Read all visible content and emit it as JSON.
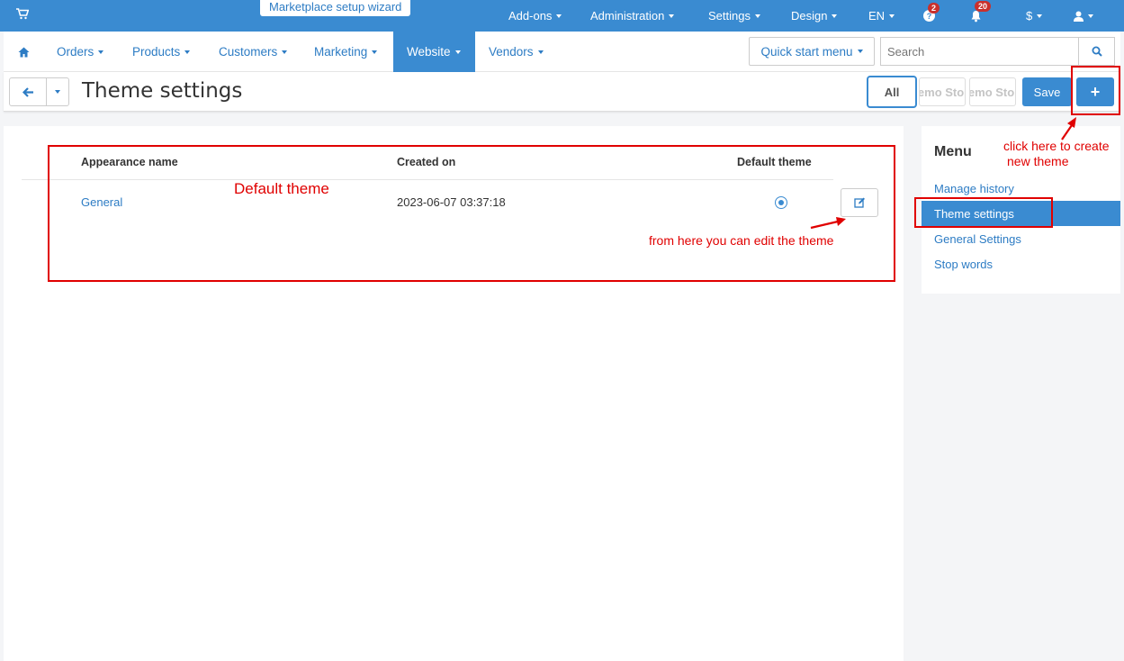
{
  "topbar": {
    "wizard_label": "Marketplace setup wizard",
    "items": [
      {
        "label": "Add-ons"
      },
      {
        "label": "Administration"
      },
      {
        "label": "Settings"
      },
      {
        "label": "Design"
      },
      {
        "label": "EN"
      },
      {
        "label": "$"
      }
    ],
    "help_badge": "2",
    "notifications_badge": "20"
  },
  "nav": {
    "items": [
      {
        "label": "Orders"
      },
      {
        "label": "Products"
      },
      {
        "label": "Customers"
      },
      {
        "label": "Marketing"
      },
      {
        "label": "Website",
        "active": true
      },
      {
        "label": "Vendors"
      }
    ],
    "quick_start_label": "Quick start menu",
    "search_placeholder": "Search"
  },
  "titlebar": {
    "title": "Theme settings",
    "all_label": "All",
    "store1_label": "Demo Store",
    "store2_label": "Demo Store",
    "save_label": "Save",
    "add_label": "+"
  },
  "table": {
    "headers": [
      "Appearance name",
      "Created on",
      "Default theme"
    ],
    "rows": [
      {
        "name": "General",
        "created_on": "2023-06-07 03:37:18",
        "default": true
      }
    ]
  },
  "sidebar": {
    "title": "Menu",
    "items": [
      {
        "label": "Manage history"
      },
      {
        "label": "Theme settings",
        "active": true
      },
      {
        "label": "General Settings"
      },
      {
        "label": "Stop words"
      }
    ]
  },
  "annotations": {
    "default_theme": "Default theme",
    "edit_note": "from here you can edit the theme",
    "create_note_line1": "click here to create",
    "create_note_line2": "new theme"
  },
  "colors": {
    "primary": "#3a8bd1",
    "link": "#2d7cc4",
    "annotation": "#e00000"
  }
}
